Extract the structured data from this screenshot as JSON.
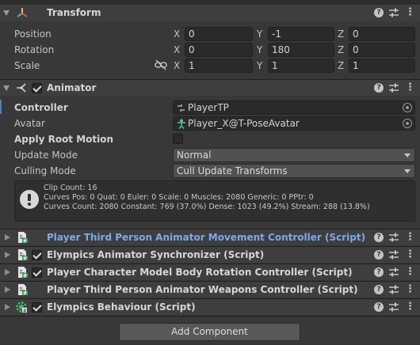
{
  "transform": {
    "title": "Transform",
    "position": {
      "label": "Position",
      "x": "0",
      "y": "-1",
      "z": "0"
    },
    "rotation": {
      "label": "Rotation",
      "x": "0",
      "y": "180",
      "z": "0"
    },
    "scale": {
      "label": "Scale",
      "x": "1",
      "y": "1",
      "z": "1"
    },
    "axis_x": "X",
    "axis_y": "Y",
    "axis_z": "Z"
  },
  "animator": {
    "title": "Animator",
    "controller_label": "Controller",
    "controller_value": "PlayerTP",
    "avatar_label": "Avatar",
    "avatar_value": "Player_X@T-PoseAvatar",
    "apply_root_motion_label": "Apply Root Motion",
    "update_mode_label": "Update Mode",
    "update_mode_value": "Normal",
    "culling_mode_label": "Culling Mode",
    "culling_mode_value": "Cull Update Transforms",
    "info": {
      "line1": "Clip Count: 16",
      "line2": "Curves Pos: 0 Quat: 0 Euler: 0 Scale: 0 Muscles: 2080 Generic: 0 PPtr: 0",
      "line3": "Curves Count: 2080 Constant: 769 (37.0%) Dense: 1023 (49.2%) Stream: 288 (13.8%)"
    }
  },
  "scripts": [
    {
      "title": "Player Third Person Animator Movement Controller (Script)",
      "checked": false,
      "highlight": true
    },
    {
      "title": "Elympics Animator Synchronizer (Script)",
      "checked": true,
      "highlight": false
    },
    {
      "title": "Player Character Model Body Rotation Controller (Script)",
      "checked": true,
      "highlight": false
    },
    {
      "title": "Player Third Person Animator Weapons Controller (Script)",
      "checked": false,
      "highlight": false
    },
    {
      "title": "Elympics Behaviour (Script)",
      "checked": true,
      "highlight": false
    }
  ],
  "add_component_label": "Add Component",
  "colors": {
    "background": "#383838",
    "header": "#3e3e3e",
    "highlight_title": "#7fa8e8",
    "focus_bar": "#4a7fc2"
  }
}
